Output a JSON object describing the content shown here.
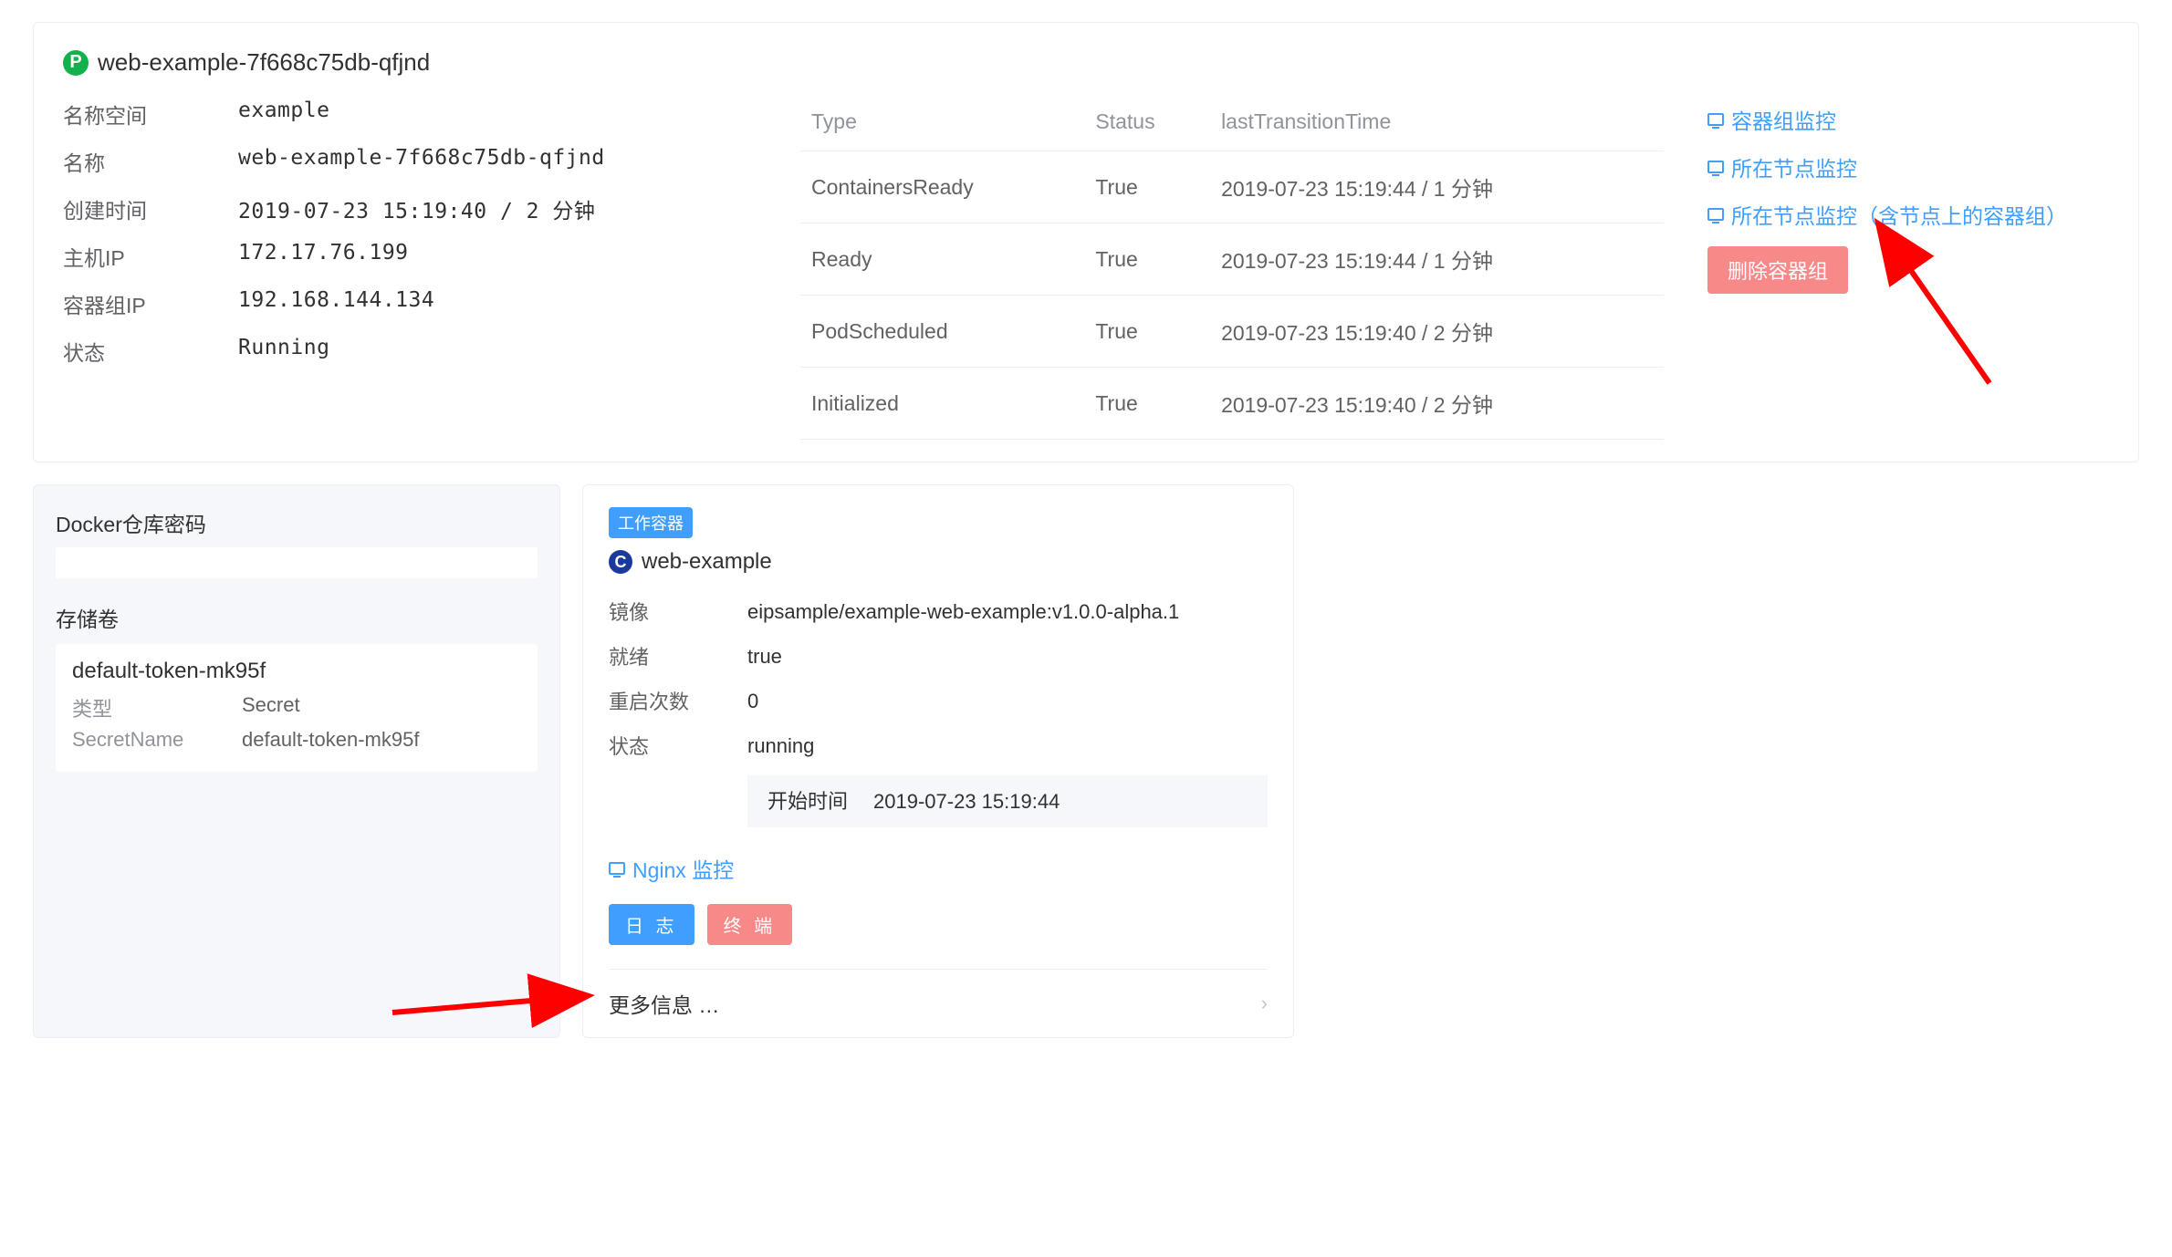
{
  "pod": {
    "badge": "P",
    "name": "web-example-7f668c75db-qfjnd",
    "fields": {
      "namespace_label": "名称空间",
      "namespace": "example",
      "name_label": "名称",
      "name_value": "web-example-7f668c75db-qfjnd",
      "created_label": "创建时间",
      "created": "2019-07-23 15:19:40 / 2 分钟",
      "host_ip_label": "主机IP",
      "host_ip": "172.17.76.199",
      "pod_ip_label": "容器组IP",
      "pod_ip": "192.168.144.134",
      "status_label": "状态",
      "status": "Running"
    }
  },
  "status_table": {
    "headers": {
      "type": "Type",
      "status": "Status",
      "time": "lastTransitionTime"
    },
    "rows": [
      {
        "type": "ContainersReady",
        "status": "True",
        "time": "2019-07-23 15:19:44 / 1 分钟"
      },
      {
        "type": "Ready",
        "status": "True",
        "time": "2019-07-23 15:19:44 / 1 分钟"
      },
      {
        "type": "PodScheduled",
        "status": "True",
        "time": "2019-07-23 15:19:40 / 2 分钟"
      },
      {
        "type": "Initialized",
        "status": "True",
        "time": "2019-07-23 15:19:40 / 2 分钟"
      }
    ]
  },
  "actions": {
    "pod_monitor": "容器组监控",
    "node_monitor": "所在节点监控",
    "node_monitor_with_pods": "所在节点监控（含节点上的容器组）",
    "delete_pod": "删除容器组"
  },
  "side": {
    "docker_secret_heading": "Docker仓库密码",
    "volumes_heading": "存储卷",
    "volume": {
      "name": "default-token-mk95f",
      "type_label": "类型",
      "type": "Secret",
      "secret_label": "SecretName",
      "secret": "default-token-mk95f"
    }
  },
  "container": {
    "tag": "工作容器",
    "badge": "C",
    "name": "web-example",
    "image_label": "镜像",
    "image": "eipsample/example-web-example:v1.0.0-alpha.1",
    "ready_label": "就绪",
    "ready": "true",
    "restarts_label": "重启次数",
    "restarts": "0",
    "state_label": "状态",
    "state": "running",
    "start_time_label": "开始时间",
    "start_time": "2019-07-23 15:19:44",
    "nginx_monitor": "Nginx 监控",
    "logs_btn": "日 志",
    "terminal_btn": "终 端",
    "more_info": "更多信息 …"
  }
}
